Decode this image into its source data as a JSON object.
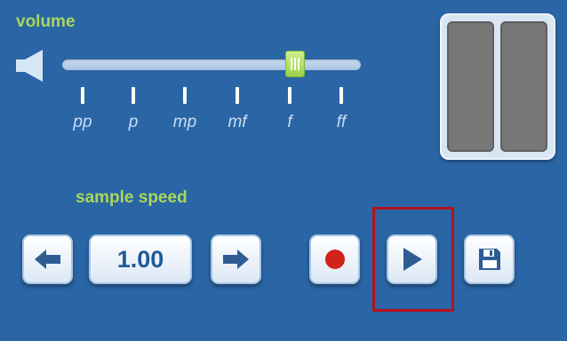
{
  "volume": {
    "label": "volume",
    "level_fraction": 0.8,
    "dynamics": [
      "pp",
      "p",
      "mp",
      "mf",
      "f",
      "ff"
    ]
  },
  "speed": {
    "label": "sample speed",
    "value": "1.00"
  },
  "icons": {
    "speaker": "speaker-icon",
    "left": "arrow-left-icon",
    "right": "arrow-right-icon",
    "record": "record-icon",
    "play": "play-icon",
    "save": "save-icon"
  },
  "colors": {
    "background": "#2a65a5",
    "accent_green": "#a9d65a",
    "record_red": "#d2231a",
    "highlight": "#b4121b"
  }
}
